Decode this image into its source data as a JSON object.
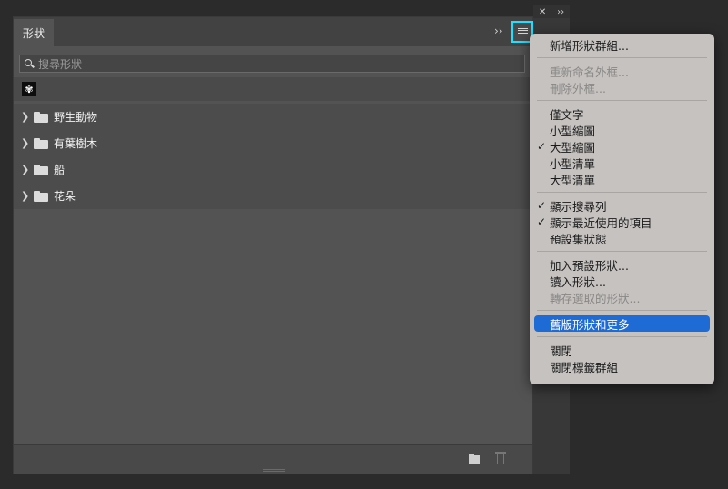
{
  "dock": {
    "close_glyph": "✕",
    "expand_glyph": "››"
  },
  "panel": {
    "tab_title": "形狀",
    "collapse_glyph": "››",
    "menu_icon": "hamburger-menu-icon",
    "search": {
      "placeholder": "搜尋形狀",
      "value": ""
    },
    "recent_shape_glyph": "✾",
    "groups": [
      {
        "label": "野生動物"
      },
      {
        "label": "有葉樹木"
      },
      {
        "label": "船"
      },
      {
        "label": "花朵"
      }
    ]
  },
  "menu": {
    "sections": [
      [
        {
          "label": "新增形狀群組...",
          "enabled": true,
          "checked": false
        }
      ],
      [
        {
          "label": "重新命名外框...",
          "enabled": false,
          "checked": false
        },
        {
          "label": "刪除外框...",
          "enabled": false,
          "checked": false
        }
      ],
      [
        {
          "label": "僅文字",
          "enabled": true,
          "checked": false
        },
        {
          "label": "小型縮圖",
          "enabled": true,
          "checked": false
        },
        {
          "label": "大型縮圖",
          "enabled": true,
          "checked": true
        },
        {
          "label": "小型清單",
          "enabled": true,
          "checked": false
        },
        {
          "label": "大型清單",
          "enabled": true,
          "checked": false
        }
      ],
      [
        {
          "label": "顯示搜尋列",
          "enabled": true,
          "checked": true
        },
        {
          "label": "顯示最近使用的項目",
          "enabled": true,
          "checked": true
        },
        {
          "label": "預設集狀態",
          "enabled": true,
          "checked": false
        }
      ],
      [
        {
          "label": "加入預設形狀...",
          "enabled": true,
          "checked": false
        },
        {
          "label": "讀入形狀...",
          "enabled": true,
          "checked": false
        },
        {
          "label": "轉存選取的形狀...",
          "enabled": false,
          "checked": false
        }
      ],
      [
        {
          "label": "舊版形狀和更多",
          "enabled": true,
          "checked": false,
          "highlighted": true
        }
      ],
      [
        {
          "label": "關閉",
          "enabled": true,
          "checked": false
        },
        {
          "label": "關閉標籤群組",
          "enabled": true,
          "checked": false
        }
      ]
    ],
    "check_glyph": "✓"
  },
  "colors": {
    "highlight": "#1f6bd6",
    "focus_ring": "#20e0ff"
  }
}
